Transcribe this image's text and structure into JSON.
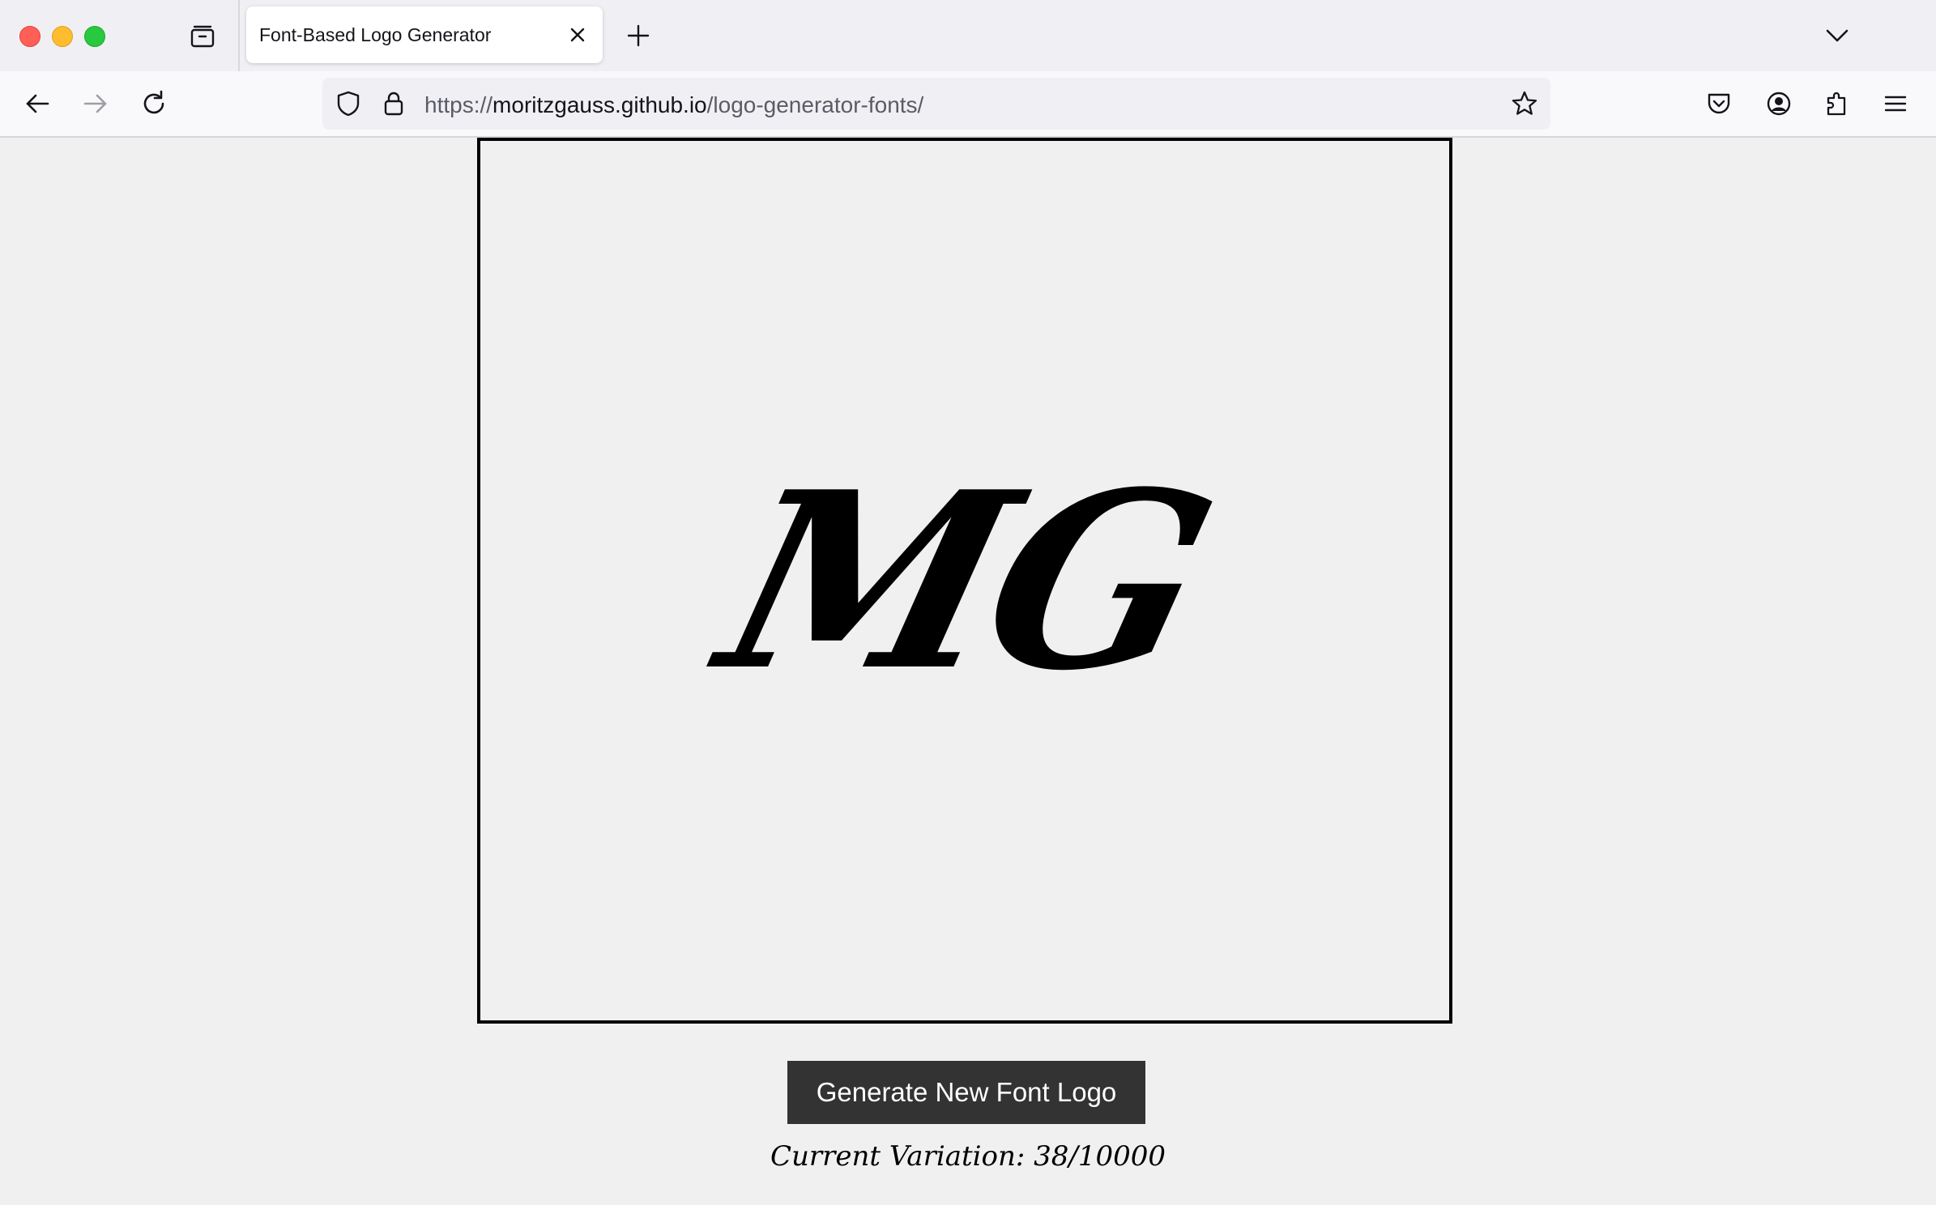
{
  "browser": {
    "tab": {
      "title": "Font-Based Logo Generator"
    },
    "url": {
      "scheme": "https://",
      "host": "moritzgauss.github.io",
      "path": "/logo-generator-fonts/"
    }
  },
  "page": {
    "logo_text": "MG",
    "button_label": "Generate New Font Logo",
    "variation_text": "Current Variation: 38/10000"
  },
  "colors": {
    "background": "#f0f0f0",
    "button": "#333333",
    "frame_border": "#000000"
  }
}
